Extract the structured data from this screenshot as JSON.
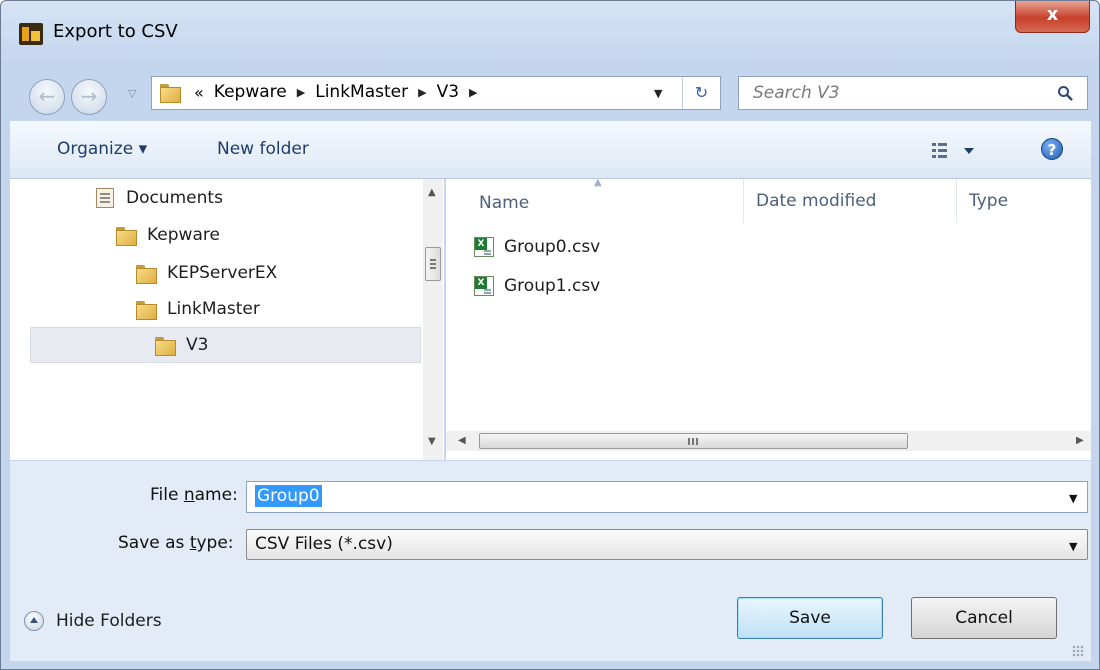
{
  "window": {
    "title": "Export to CSV",
    "close_label": "x"
  },
  "address": {
    "lead": "«",
    "crumbs": [
      "Kepware",
      "LinkMaster",
      "V3"
    ]
  },
  "search": {
    "placeholder": "Search V3"
  },
  "toolbar": {
    "organize_label": "Organize ▾",
    "new_folder_label": "New folder",
    "help_label": "?"
  },
  "navigation": {
    "items": [
      {
        "label": "Documents",
        "icon": "document-library-icon"
      },
      {
        "label": "Kepware",
        "icon": "folder-icon"
      },
      {
        "label": "KEPServerEX",
        "icon": "folder-icon"
      },
      {
        "label": "LinkMaster",
        "icon": "folder-icon"
      },
      {
        "label": "V3",
        "icon": "folder-icon",
        "selected": true
      }
    ]
  },
  "file_list": {
    "columns": [
      "Name",
      "Date modified",
      "Type"
    ],
    "files": [
      {
        "name": "Group0.csv",
        "icon": "csv-file-icon"
      },
      {
        "name": "Group1.csv",
        "icon": "csv-file-icon"
      }
    ]
  },
  "form": {
    "file_name_label_prefix": "File ",
    "file_name_label_underline": "n",
    "file_name_label_suffix": "ame:",
    "file_name_value": "Group0",
    "save_type_label_prefix": "Save as ",
    "save_type_label_underline": "t",
    "save_type_label_suffix": "ype:",
    "save_type_value": "CSV Files (*.csv)"
  },
  "footer": {
    "hide_folders_label": "Hide Folders",
    "save_label": "Save",
    "cancel_label": "Cancel"
  },
  "colors": {
    "window_frame": "#c4d6ee",
    "selection": "#3399ff",
    "close_button": "#c7402a"
  }
}
